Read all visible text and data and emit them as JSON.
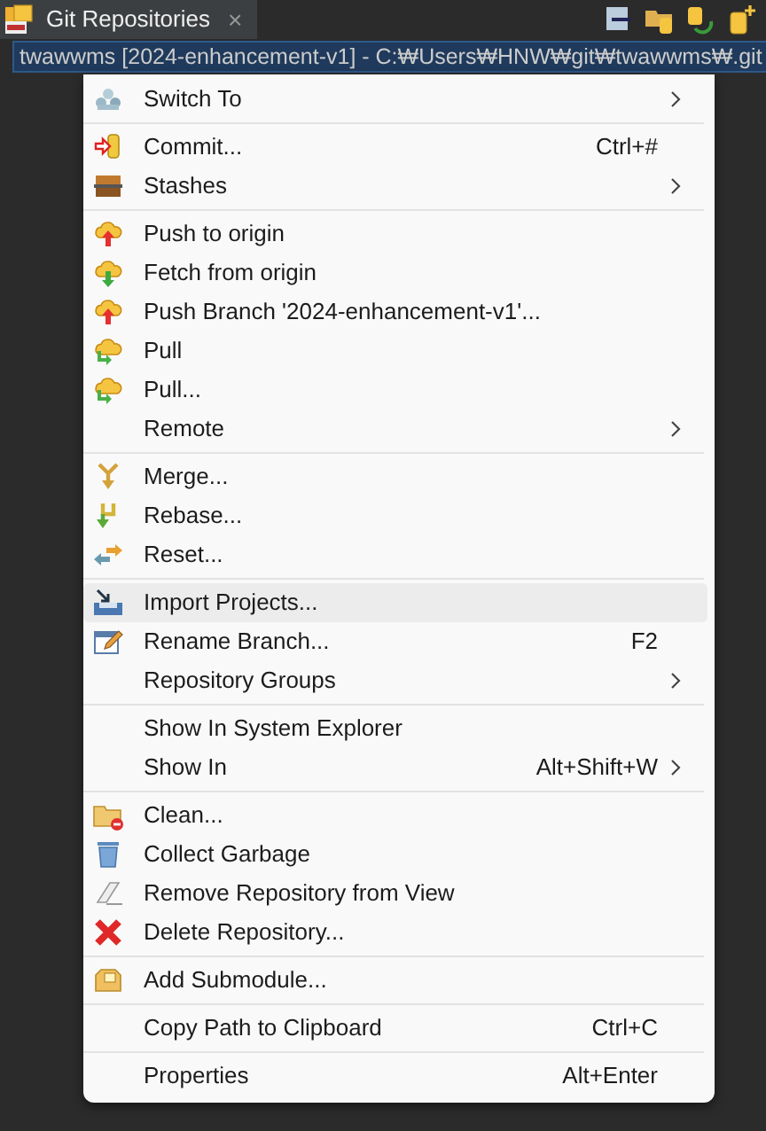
{
  "view_tab": {
    "title": "Git Repositories",
    "close": "×"
  },
  "tree": {
    "row": "twawwms [2024-enhancement-v1] - C:₩Users₩HNW₩git₩twawwms₩.git",
    "selected": true
  },
  "context_menu": {
    "groups": [
      [
        {
          "label": "Switch To",
          "submenu": true,
          "highlighted": false
        }
      ],
      [
        {
          "label": "Commit...",
          "shortcut": "Ctrl+#",
          "submenu": false,
          "highlighted": false
        },
        {
          "label": "Stashes",
          "submenu": true,
          "highlighted": false
        }
      ],
      [
        {
          "label": "Push to origin",
          "submenu": false,
          "highlighted": false
        },
        {
          "label": "Fetch from origin",
          "submenu": false,
          "highlighted": false
        },
        {
          "label": "Push Branch '2024-enhancement-v1'...",
          "submenu": false,
          "highlighted": false
        },
        {
          "label": "Pull",
          "submenu": false,
          "highlighted": false
        },
        {
          "label": "Pull...",
          "submenu": false,
          "highlighted": false
        },
        {
          "label": "Remote",
          "submenu": true,
          "highlighted": false
        }
      ],
      [
        {
          "label": "Merge...",
          "submenu": false,
          "highlighted": false
        },
        {
          "label": "Rebase...",
          "submenu": false,
          "highlighted": false
        },
        {
          "label": "Reset...",
          "submenu": false,
          "highlighted": false
        }
      ],
      [
        {
          "label": "Import Projects...",
          "submenu": false,
          "highlighted": true
        },
        {
          "label": "Rename Branch...",
          "shortcut": "F2",
          "submenu": false,
          "highlighted": false
        },
        {
          "label": "Repository Groups",
          "submenu": true,
          "highlighted": false
        }
      ],
      [
        {
          "label": "Show In System Explorer",
          "submenu": false,
          "highlighted": false
        },
        {
          "label": "Show In",
          "shortcut": "Alt+Shift+W",
          "submenu": true,
          "highlighted": false
        }
      ],
      [
        {
          "label": "Clean...",
          "submenu": false,
          "highlighted": false
        },
        {
          "label": "Collect Garbage",
          "submenu": false,
          "highlighted": false
        },
        {
          "label": "Remove Repository from View",
          "submenu": false,
          "highlighted": false
        },
        {
          "label": "Delete Repository...",
          "submenu": false,
          "highlighted": false
        }
      ],
      [
        {
          "label": "Add Submodule...",
          "submenu": false,
          "highlighted": false
        }
      ],
      [
        {
          "label": "Copy Path to Clipboard",
          "shortcut": "Ctrl+C",
          "submenu": false,
          "highlighted": false
        }
      ],
      [
        {
          "label": "Properties",
          "shortcut": "Alt+Enter",
          "submenu": false,
          "highlighted": false
        }
      ]
    ]
  }
}
